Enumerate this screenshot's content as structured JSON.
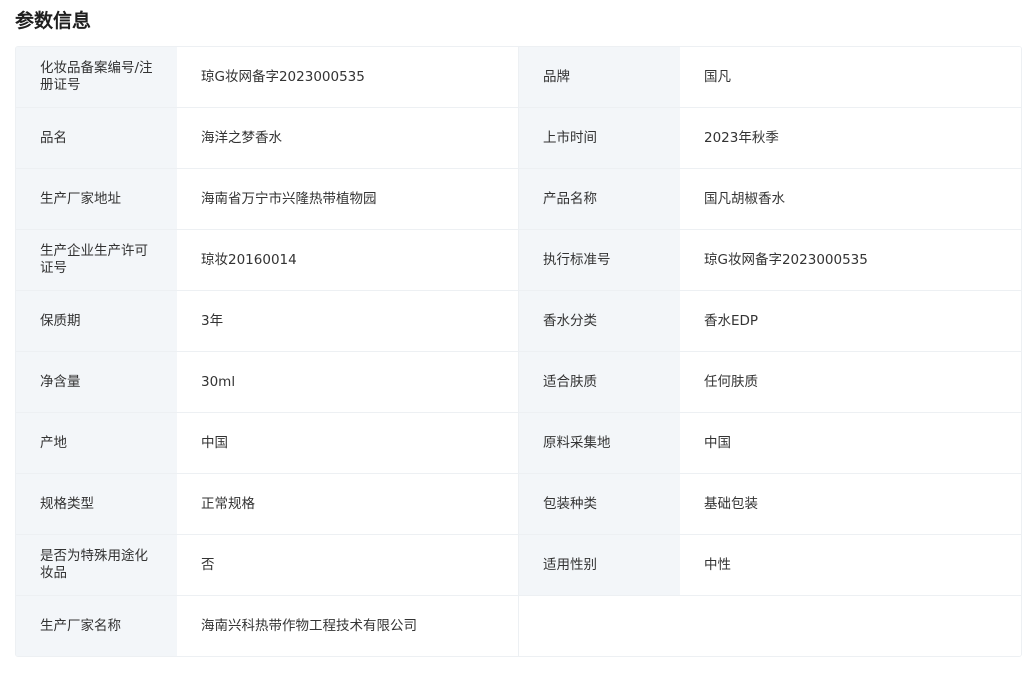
{
  "section_title": "参数信息",
  "rows": [
    {
      "label1": "化妆品备案编号/注册证号",
      "value1": "琼G妆网备字2023000535",
      "label2": "品牌",
      "value2": "国凡"
    },
    {
      "label1": "品名",
      "value1": "海洋之梦香水",
      "label2": "上市时间",
      "value2": "2023年秋季"
    },
    {
      "label1": "生产厂家地址",
      "value1": "海南省万宁市兴隆热带植物园",
      "label2": "产品名称",
      "value2": "国凡胡椒香水"
    },
    {
      "label1": "生产企业生产许可证号",
      "value1": "琼妆20160014",
      "label2": "执行标准号",
      "value2": "琼G妆网备字2023000535"
    },
    {
      "label1": "保质期",
      "value1": "3年",
      "label2": "香水分类",
      "value2": "香水EDP"
    },
    {
      "label1": "净含量",
      "value1": "30ml",
      "label2": "适合肤质",
      "value2": "任何肤质"
    },
    {
      "label1": "产地",
      "value1": "中国",
      "label2": "原料采集地",
      "value2": "中国"
    },
    {
      "label1": "规格类型",
      "value1": "正常规格",
      "label2": "包装种类",
      "value2": "基础包装"
    },
    {
      "label1": "是否为特殊用途化妆品",
      "value1": "否",
      "label2": "适用性别",
      "value2": "中性"
    },
    {
      "label1": "生产厂家名称",
      "value1": "海南兴科热带作物工程技术有限公司",
      "label2": "",
      "value2": ""
    }
  ]
}
